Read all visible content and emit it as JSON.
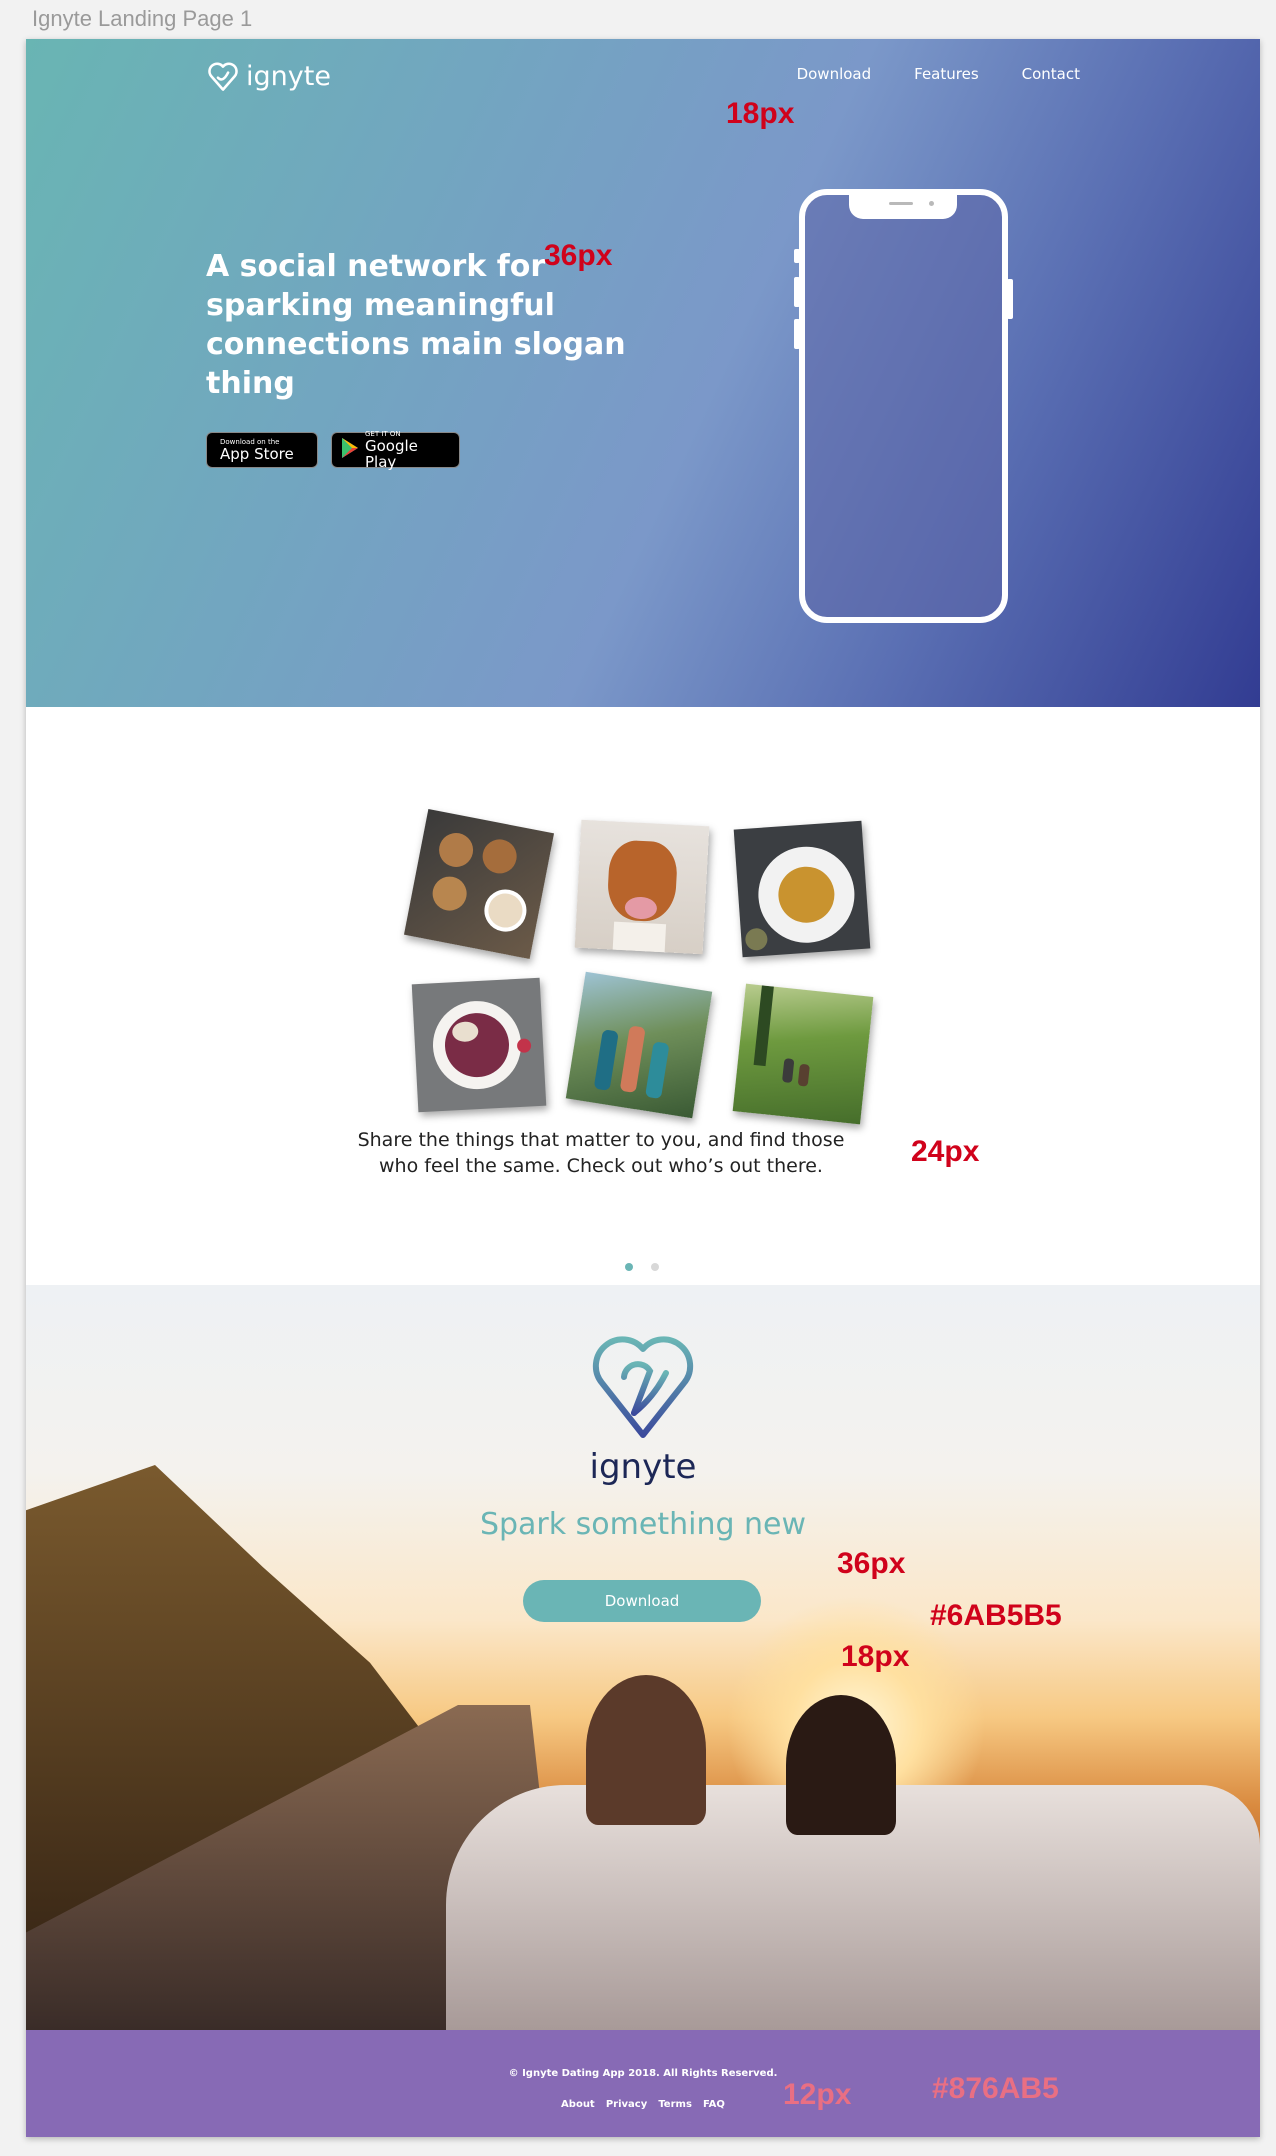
{
  "frame_title": "Ignyte Landing Page 1",
  "header": {
    "logo_text": "ignyte",
    "nav": [
      "Download",
      "Features",
      "Contact"
    ]
  },
  "hero": {
    "slogan": "A social network for sparking meaningful connections main slogan thing",
    "app_store": {
      "small": "Download on the",
      "big": "App Store"
    },
    "google_play": {
      "small": "GET IT ON",
      "big": "Google Play"
    }
  },
  "gallery": {
    "photos": [
      "cookies-coffee-photo",
      "dog-photo",
      "pasta-photo",
      "acai-bowl-photo",
      "hikers-photo",
      "hiking-trail-photo"
    ],
    "caption": "Share the things that matter to you, and find those who feel the same. Check out who’s out there.",
    "dots": 2,
    "active_dot": 0
  },
  "spark": {
    "brand": "ignyte",
    "tagline": "Spark something new",
    "button": "Download",
    "accent_color": "#6AB5B5"
  },
  "footer": {
    "copyright": "© Ignyte Dating App 2018. All Rights Reserved.",
    "links": [
      "About",
      "Privacy",
      "Terms",
      "FAQ"
    ],
    "background_color": "#876AB5"
  },
  "annotations": {
    "nav_size": "18px",
    "slogan_size": "36px",
    "caption_size": "24px",
    "tagline_size": "36px",
    "accent_hex": "#6AB5B5",
    "button_size": "18px",
    "footer_size": "12px",
    "footer_hex": "#876AB5"
  }
}
